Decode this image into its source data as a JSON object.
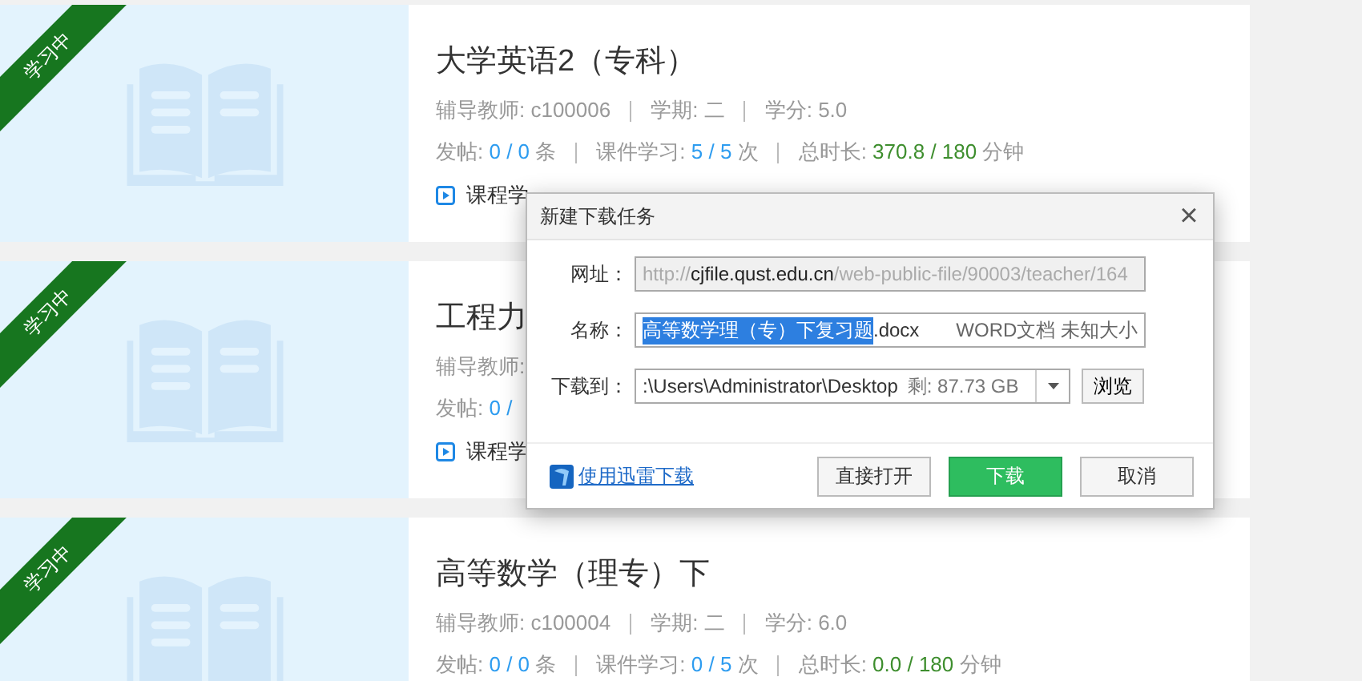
{
  "courses": [
    {
      "badge": "学习中",
      "title": "大学英语2（专科）",
      "meta": [
        "辅导教师: c100006",
        "学期: 二",
        "学分: 5.0"
      ],
      "stats": [
        {
          "label": "发帖:",
          "value": "0 / 0",
          "unit": "条",
          "kind": "count"
        },
        {
          "label": "课件学习:",
          "value": "5 / 5",
          "unit": "次",
          "kind": "count"
        },
        {
          "label": "总时长:",
          "value": "370.8 / 180",
          "unit": "分钟",
          "kind": "time"
        }
      ],
      "links": [
        "课程学"
      ]
    },
    {
      "badge": "学习中",
      "title": "工程力",
      "meta": [
        "辅导教师:"
      ],
      "stats": [
        {
          "label": "发帖:",
          "value": "0 /",
          "kind": "count"
        }
      ],
      "links": [
        "课程学"
      ]
    },
    {
      "badge": "学习中",
      "title": "高等数学（理专）下",
      "meta": [
        "辅导教师: c100004",
        "学期: 二",
        "学分: 6.0"
      ],
      "stats": [
        {
          "label": "发帖:",
          "value": "0 / 0",
          "unit": "条",
          "kind": "count"
        },
        {
          "label": "课件学习:",
          "value": "0 / 5",
          "unit": "次",
          "kind": "count"
        },
        {
          "label": "总时长:",
          "value": "0.0 / 180",
          "unit": "分钟",
          "kind": "time"
        }
      ]
    }
  ],
  "dialog": {
    "title": "新建下载任务",
    "close": "×",
    "url_label": "网址：",
    "url_prefix": "http://",
    "url_host": "cjfile.qust.edu.cn",
    "url_path": "/web-public-file/90003/teacher/164",
    "name_label": "名称：",
    "name_selected": "高等数学理（专）下复习题",
    "name_rest": ".docx",
    "file_info": "WORD文档 未知大小",
    "dest_label": "下载到：",
    "dest_path": ":\\Users\\Administrator\\Desktop",
    "dest_free": "剩: 87.73 GB",
    "browse": "浏览",
    "thunder_link": "使用迅雷下载",
    "buttons": [
      {
        "label": "直接打开",
        "kind": "plain"
      },
      {
        "label": "下载",
        "kind": "primary"
      },
      {
        "label": "取消",
        "kind": "plain"
      }
    ]
  }
}
